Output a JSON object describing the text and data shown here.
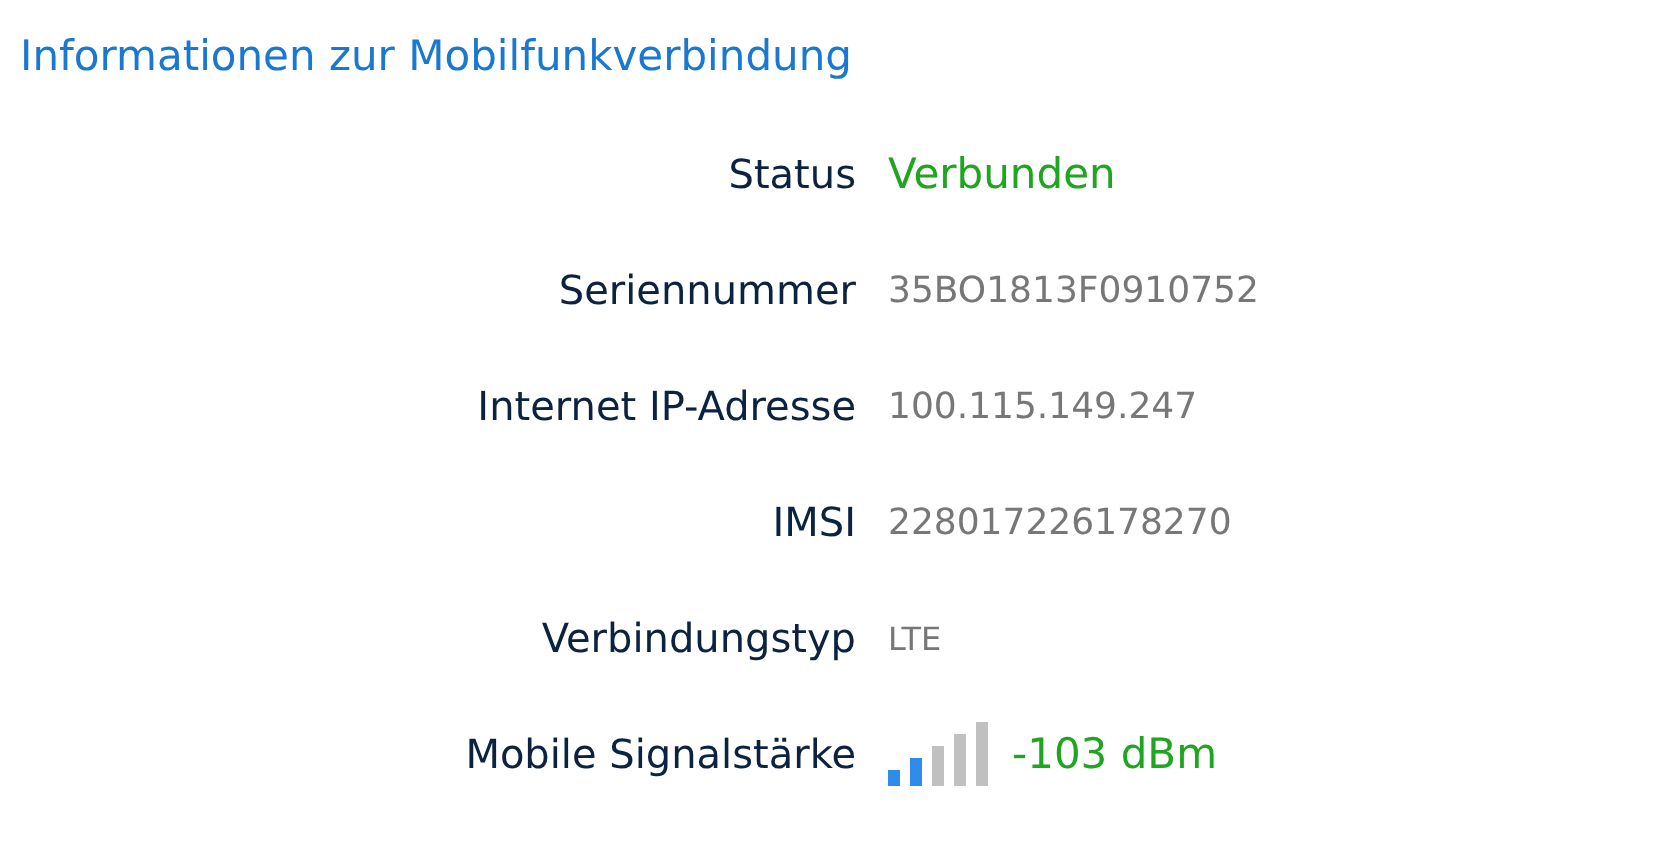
{
  "title": "Informationen zur Mobilfunkverbindung",
  "rows": [
    {
      "label": "Status",
      "value": "Verbunden",
      "kind": "status"
    },
    {
      "label": "Seriennummer",
      "value": "35BO1813F0910752",
      "kind": "plain"
    },
    {
      "label": "Internet IP-Adresse",
      "value": "100.115.149.247",
      "kind": "plain"
    },
    {
      "label": "IMSI",
      "value": "228017226178270",
      "kind": "plain"
    },
    {
      "label": "Verbindungstyp",
      "value": "LTE",
      "kind": "small"
    },
    {
      "label": "Mobile Signalstärke",
      "value": "-103 dBm",
      "kind": "signal"
    }
  ]
}
